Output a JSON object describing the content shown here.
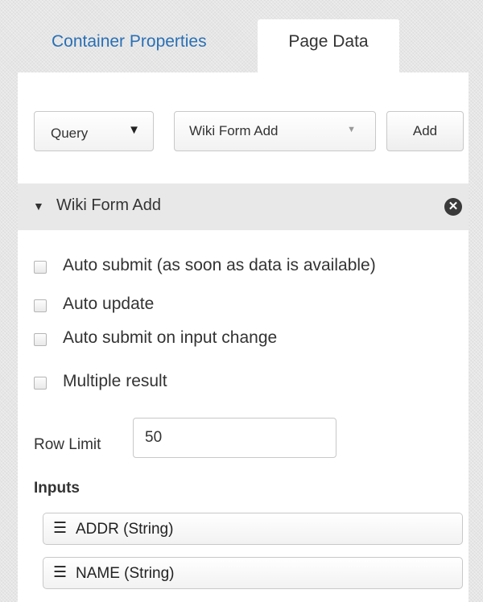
{
  "tabs": [
    {
      "label": "Container Properties",
      "active": false
    },
    {
      "label": "Page Data",
      "active": true
    }
  ],
  "toolbar": {
    "query_select": "Query",
    "form_select": "Wiki Form Add",
    "add_label": "Add"
  },
  "section": {
    "title": "Wiki Form Add"
  },
  "checkboxes": [
    {
      "label": "Auto submit (as soon as data is available)",
      "checked": false
    },
    {
      "label": "Auto update",
      "checked": false
    },
    {
      "label": "Auto submit on input change",
      "checked": false
    },
    {
      "label": "Multiple result",
      "checked": false
    }
  ],
  "row_limit": {
    "label": "Row Limit",
    "value": "50"
  },
  "inputs": {
    "title": "Inputs",
    "items": [
      "ADDR (String)",
      "NAME (String)"
    ]
  },
  "colors": {
    "tab_link": "#2a6fb5",
    "header_bg": "#e8e8e8"
  },
  "icons": {
    "dropdown": "caret-down-icon",
    "section_toggle": "caret-down-icon",
    "remove": "close-circle-icon",
    "drag": "drag-handle-icon"
  }
}
